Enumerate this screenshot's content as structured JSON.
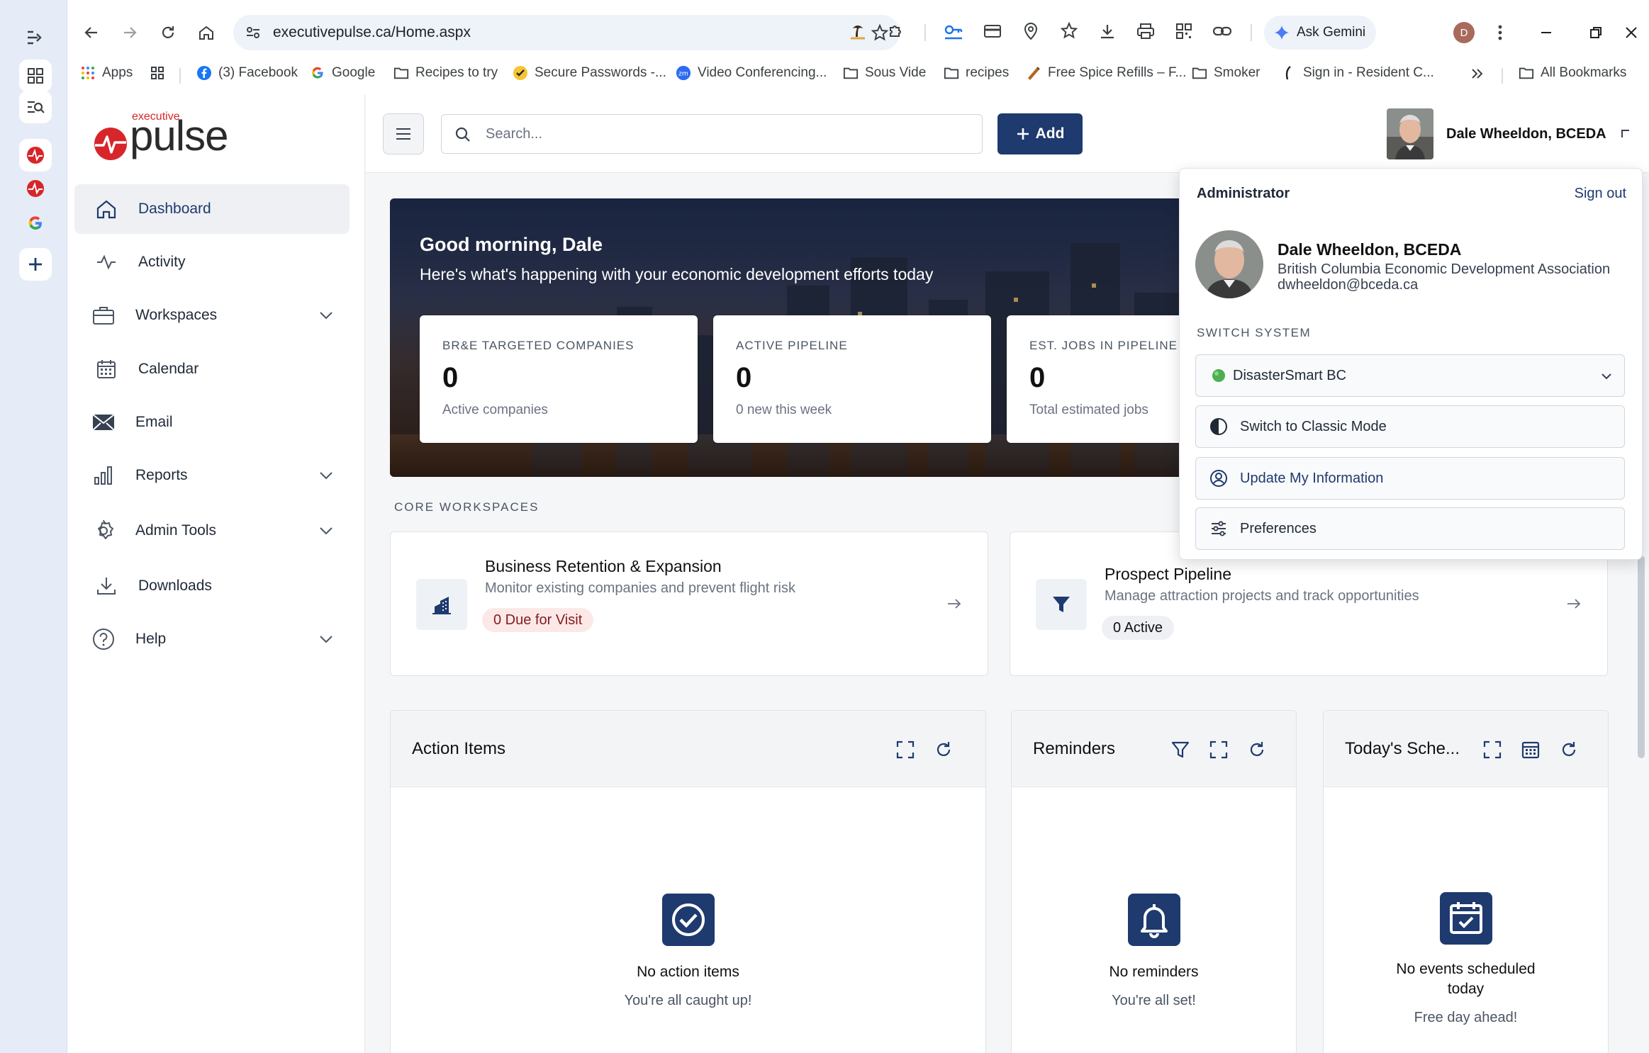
{
  "browser": {
    "url": "executivepulse.ca/Home.aspx",
    "gemini_label": "Ask Gemini",
    "profile_initial": "D",
    "bookmarks": [
      {
        "label": "Apps",
        "icon": "apps-grid-icon"
      },
      {
        "label": "",
        "icon": "grid-icon"
      },
      {
        "label": "(3) Facebook",
        "icon": "facebook-icon"
      },
      {
        "label": "Google",
        "icon": "google-icon"
      },
      {
        "label": "Recipes to try",
        "icon": "folder-icon"
      },
      {
        "label": "Secure Passwords -...",
        "icon": "check-circle-icon"
      },
      {
        "label": "Video Conferencing...",
        "icon": "zoom-icon"
      },
      {
        "label": "Sous Vide",
        "icon": "folder-icon"
      },
      {
        "label": "recipes",
        "icon": "folder-icon"
      },
      {
        "label": "Free Spice Refills – F...",
        "icon": "spice-icon"
      },
      {
        "label": "Smoker",
        "icon": "folder-icon"
      },
      {
        "label": "Sign in - Resident C...",
        "icon": "feather-icon"
      }
    ],
    "all_bookmarks": "All Bookmarks",
    "colors": {
      "accent": "#1e3a6e",
      "brand_red": "#d7262b"
    }
  },
  "app": {
    "logo_small": "executive",
    "logo_big": "pulse",
    "nav": [
      {
        "label": "Dashboard",
        "icon": "home-icon",
        "active": true
      },
      {
        "label": "Activity",
        "icon": "activity-icon"
      },
      {
        "label": "Workspaces",
        "icon": "briefcase-icon",
        "expandable": true
      },
      {
        "label": "Calendar",
        "icon": "calendar-icon"
      },
      {
        "label": "Email",
        "icon": "email-icon"
      },
      {
        "label": "Reports",
        "icon": "bar-chart-icon",
        "expandable": true
      },
      {
        "label": "Admin Tools",
        "icon": "gear-icon",
        "expandable": true
      },
      {
        "label": "Downloads",
        "icon": "download-icon"
      },
      {
        "label": "Help",
        "icon": "help-icon",
        "expandable": true
      }
    ],
    "search_placeholder": "Search...",
    "add_label": "Add",
    "user_name": "Dale Wheeldon, BCEDA"
  },
  "hero": {
    "greeting": "Good morning, Dale",
    "subtitle": "Here's what's happening with your economic development efforts today",
    "stats": [
      {
        "label": "BR&E TARGETED COMPANIES",
        "value": "0",
        "sub": "Active companies"
      },
      {
        "label": "ACTIVE PIPELINE",
        "value": "0",
        "sub": "0 new this week"
      },
      {
        "label": "EST. JOBS IN PIPELINE",
        "value": "0",
        "sub": "Total estimated jobs"
      }
    ]
  },
  "core_workspaces": {
    "title": "CORE WORKSPACES",
    "cards": [
      {
        "title": "Business Retention & Expansion",
        "desc": "Monitor existing companies and prevent flight risk",
        "badge": "0 Due for Visit"
      },
      {
        "title": "Prospect Pipeline",
        "desc": "Manage attraction projects and track opportunities",
        "badge": "0 Active"
      }
    ]
  },
  "panels": [
    {
      "title": "Action Items",
      "empty_title": "No action items",
      "empty_sub": "You're all caught up!"
    },
    {
      "title": "Reminders",
      "empty_title": "No reminders",
      "empty_sub": "You're all set!"
    },
    {
      "title": "Today's Sche...",
      "empty_title_1": "No events scheduled",
      "empty_title_2": "today",
      "empty_sub": "Free day ahead!"
    }
  ],
  "dropdown": {
    "role": "Administrator",
    "sign_out": "Sign out",
    "name": "Dale Wheeldon, BCEDA",
    "org": "British Columbia Economic Development Association",
    "email": "dwheeldon@bceda.ca",
    "switch_label": "SWITCH SYSTEM",
    "system_selected": "DisasterSmart BC",
    "classic_mode": "Switch to Classic Mode",
    "update_info": "Update My Information",
    "preferences": "Preferences"
  }
}
